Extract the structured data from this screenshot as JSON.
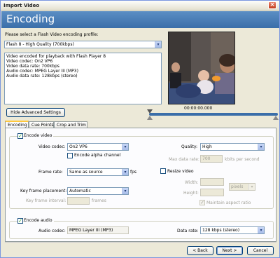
{
  "window": {
    "title": "Import Video",
    "close_glyph": "×"
  },
  "header": {
    "title": "Encoding"
  },
  "profile": {
    "prompt": "Please select a Flash Video encoding profile:",
    "selected": "Flash 8 - High Quality (700kbps)",
    "description": [
      "Video encoded for playback with Flash Player 8",
      "Video codec: On2 VP6",
      "Video data rate: 700kbps",
      "Audio codec: MPEG Layer III (MP3)",
      "Audio data rate: 128kbps (stereo)"
    ]
  },
  "preview": {
    "timecode": "00:00:00.000",
    "playhead": 0.0
  },
  "advanced_button": "Hide Advanced Settings",
  "tabs": [
    "Encoding",
    "Cue Points",
    "Crop and Trim"
  ],
  "encode_video": {
    "label": "Encode video",
    "checked": true,
    "video_codec_label": "Video codec:",
    "video_codec": "On2 VP6",
    "alpha_label": "Encode alpha channel",
    "alpha_checked": false,
    "frame_rate_label": "Frame rate:",
    "frame_rate": "Same as source",
    "fps": "fps",
    "key_frame_label": "Key frame placement:",
    "key_frame": "Automatic",
    "key_interval_label": "Key frame interval:",
    "key_interval": "",
    "frames": "frames",
    "quality_label": "Quality:",
    "quality": "High",
    "max_rate_label": "Max data rate:",
    "max_rate": "700",
    "kbits": "kbits per second",
    "resize_label": "Resize video",
    "resize_checked": false,
    "width_label": "Width:",
    "height_label": "Height:",
    "units": "pixels",
    "aspect_label": "Maintain aspect ratio",
    "aspect_checked": true
  },
  "encode_audio": {
    "label": "Encode audio",
    "checked": true,
    "codec_label": "Audio codec:",
    "codec": "MPEG Layer III (MP3)",
    "rate_label": "Data rate:",
    "rate": "128 kbps (stereo)"
  },
  "footer": {
    "back": "< Back",
    "next": "Next >",
    "cancel": "Cancel"
  },
  "icons": {
    "check": "✓",
    "dropdown": "▾"
  },
  "colors": {
    "header": "#3a6ea9",
    "tab_highlight": "#ffc83c"
  }
}
